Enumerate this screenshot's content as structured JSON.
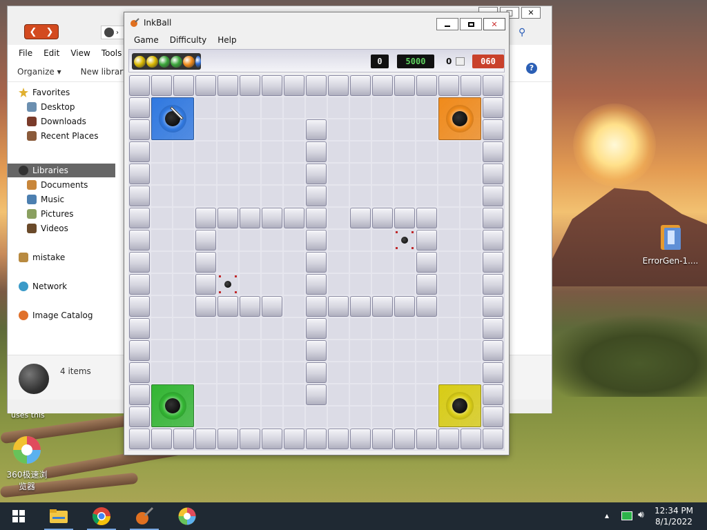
{
  "desktop": {
    "icons": [
      {
        "label": "ErrorGen-1...."
      },
      {
        "label": "360极速浏览器"
      }
    ],
    "partial_text": "uses this"
  },
  "explorer": {
    "menu": [
      "File",
      "Edit",
      "View",
      "Tools",
      "H"
    ],
    "toolbar": {
      "organize": "Organize ▾",
      "new_library": "New library"
    },
    "nav": {
      "favorites": "Favorites",
      "desktop": "Desktop",
      "downloads": "Downloads",
      "recent": "Recent Places",
      "libraries": "Libraries",
      "documents": "Documents",
      "music": "Music",
      "pictures": "Pictures",
      "videos": "Videos",
      "mistake": "mistake",
      "network": "Network",
      "image_catalog": "Image Catalog"
    },
    "status": "4 items"
  },
  "inkball": {
    "title": "InkBall",
    "menu": {
      "game": "Game",
      "difficulty": "Difficulty",
      "help": "Help"
    },
    "queue_colors": [
      "#d9b800",
      "#d9b800",
      "#3aa53a",
      "#3aa53a",
      "#f08a1a",
      "#2f6fd8"
    ],
    "score": "0",
    "target": "5000",
    "lost": "0",
    "timer": "060",
    "holes": {
      "blue": "#2f78e0",
      "orange": "#f08a1a",
      "green": "#32b532",
      "yellow": "#d8cc14"
    }
  },
  "taskbar": {
    "clock_time": "12:34 PM",
    "clock_date": "8/1/2022"
  }
}
